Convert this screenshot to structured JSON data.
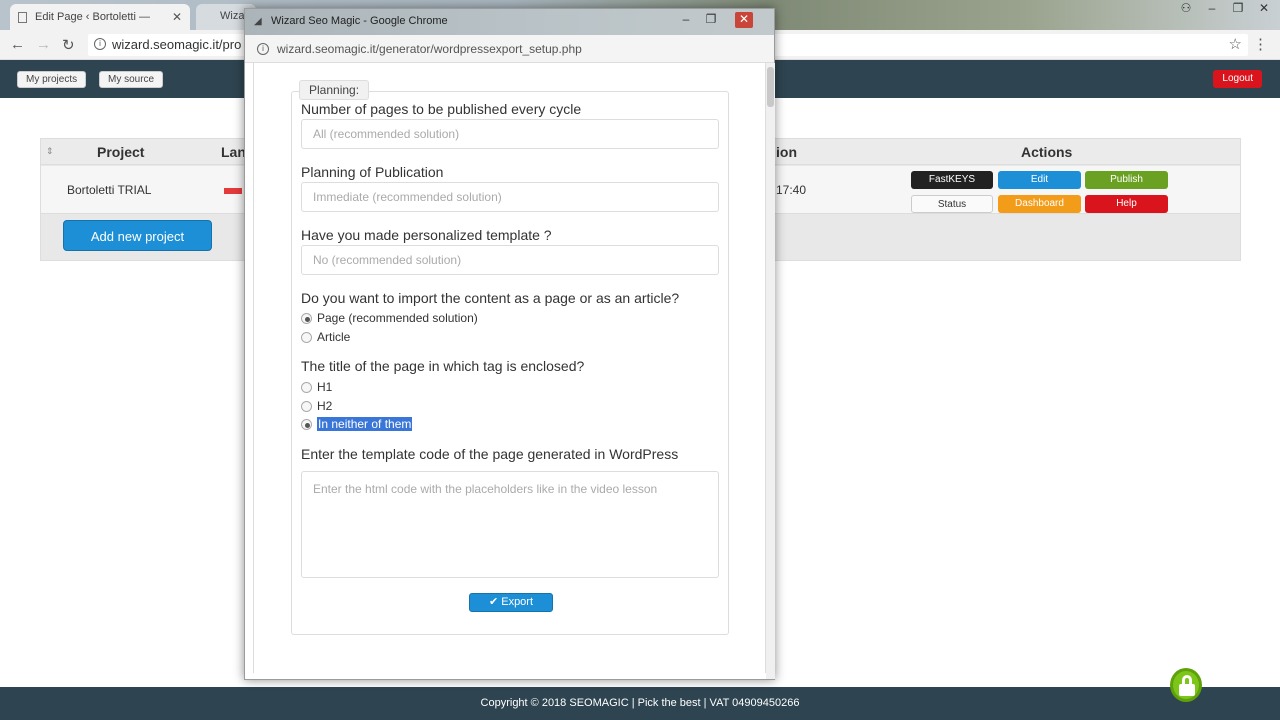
{
  "browser": {
    "active_tab_title": "Edit Page ‹ Bortoletti —",
    "second_tab_title": "Wiza",
    "url": "wizard.seomagic.it/pro",
    "nav": {
      "back": "←",
      "forward": "→",
      "reload": "↻"
    },
    "star_icon": "☆",
    "menu_icon": "⋮"
  },
  "site": {
    "header": {
      "my_projects": "My projects",
      "my_source": "My source",
      "logout": "Logout"
    },
    "table": {
      "headers": {
        "project": "Project",
        "language": "Lan",
        "date": "ion",
        "actions": "Actions"
      },
      "rows": [
        {
          "project": "Bortoletti TRIAL",
          "time": "17:40"
        }
      ],
      "actions": {
        "fastkeys": "FastKEYS",
        "edit": "Edit",
        "publish": "Publish",
        "status": "Status",
        "dashboard": "Dashboard",
        "help": "Help"
      },
      "add_project": "Add new project"
    },
    "footer": "Copyright © 2018 SEOMAGIC | Pick the best | VAT 04909450266",
    "colors": {
      "header": "#2e4450",
      "blue": "#1d8fd6",
      "red": "#d9141d",
      "green": "#6aa122",
      "orange": "#f39c1a"
    }
  },
  "popup": {
    "title": "Wizard Seo Magic - Google Chrome",
    "url": "wizard.seomagic.it/generator/wordpressexport_setup.php",
    "legend": "Planning:",
    "pages_label": "Number of pages to be published every cycle",
    "pages_value": "All (recommended solution)",
    "planning_label": "Planning of Publication",
    "planning_value": "Immediate (recommended solution)",
    "template_label": "Have you made personalized template ?",
    "template_value": "No (recommended solution)",
    "import_label": "Do you want to import the content as a page or as an article?",
    "import_options": [
      "Page (recommended solution)",
      "Article"
    ],
    "tag_label": "The title of the page in which tag is enclosed?",
    "tag_options": [
      "H1",
      "H2",
      "In neither of them"
    ],
    "code_label": "Enter the template code of the page generated in WordPress",
    "code_placeholder": "Enter the html code with the placeholders like in the video lesson",
    "export_button": "✔ Export"
  }
}
